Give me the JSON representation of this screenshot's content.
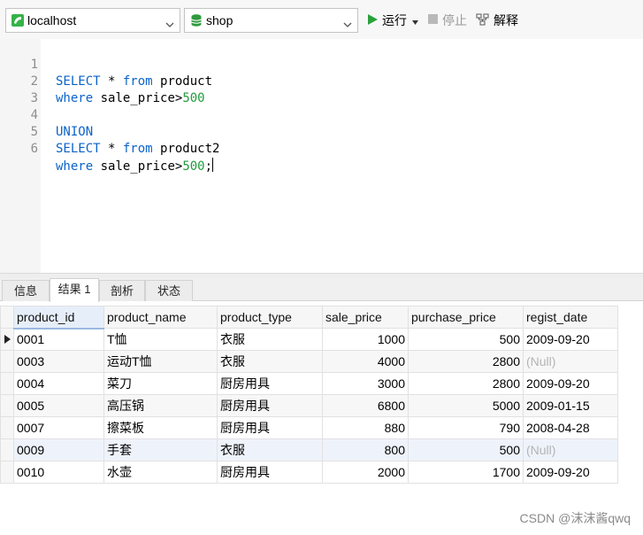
{
  "toolbar": {
    "connection": "localhost",
    "database": "shop",
    "run_label": "运行",
    "stop_label": "停止",
    "explain_label": "解释",
    "colors": {
      "run": "#2aa13a",
      "db_icon": "#2f9a3f",
      "conn_icon": "#36b24a"
    }
  },
  "editor": {
    "lines": [
      {
        "n": "1",
        "kw": "SELECT",
        "mid": " * ",
        "kw2": "from",
        "rest": " product",
        "num": "",
        "tail": ""
      },
      {
        "n": "2",
        "kw": "where",
        "mid": " sale_price>",
        "kw2": "",
        "rest": "",
        "num": "500",
        "tail": ""
      },
      {
        "n": "3",
        "kw": "",
        "mid": "",
        "kw2": "",
        "rest": "",
        "num": "",
        "tail": ""
      },
      {
        "n": "4",
        "kw": "UNION",
        "mid": "",
        "kw2": "",
        "rest": "",
        "num": "",
        "tail": ""
      },
      {
        "n": "5",
        "kw": "SELECT",
        "mid": " * ",
        "kw2": "from",
        "rest": " product2",
        "num": "",
        "tail": ""
      },
      {
        "n": "6",
        "kw": "where",
        "mid": " sale_price>",
        "kw2": "",
        "rest": "",
        "num": "500",
        "tail": ";"
      }
    ]
  },
  "tabs": [
    "信息",
    "结果 1",
    "剖析",
    "状态"
  ],
  "grid": {
    "columns": [
      "product_id",
      "product_name",
      "product_type",
      "sale_price",
      "purchase_price",
      "regist_date"
    ],
    "rows": [
      [
        "0001",
        "T恤",
        "衣服",
        "1000",
        "500",
        "2009-09-20"
      ],
      [
        "0003",
        "运动T恤",
        "衣服",
        "4000",
        "2800",
        "(Null)"
      ],
      [
        "0004",
        "菜刀",
        "厨房用具",
        "3000",
        "2800",
        "2009-09-20"
      ],
      [
        "0005",
        "高压锅",
        "厨房用具",
        "6800",
        "5000",
        "2009-01-15"
      ],
      [
        "0007",
        "擦菜板",
        "厨房用具",
        "880",
        "790",
        "2008-04-28"
      ],
      [
        "0009",
        "手套",
        "衣服",
        "800",
        "500",
        "(Null)"
      ],
      [
        "0010",
        "水壶",
        "厨房用具",
        "2000",
        "1700",
        "2009-09-20"
      ]
    ]
  },
  "watermark": "CSDN @沫沫酱qwq"
}
